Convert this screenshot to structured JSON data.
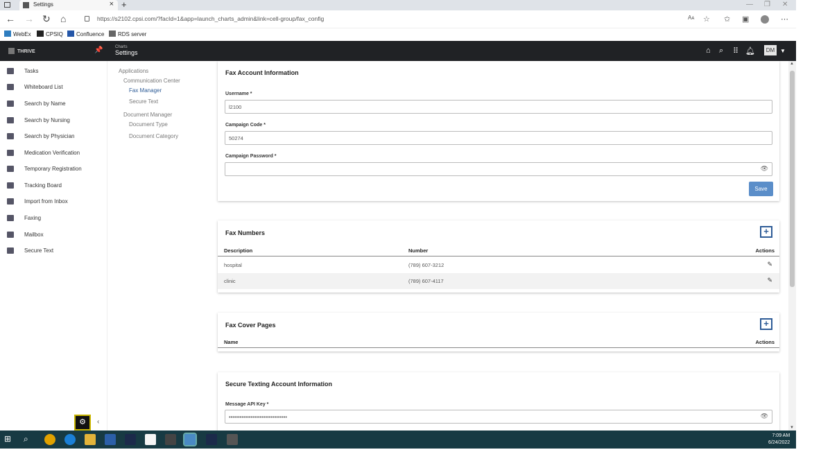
{
  "browser": {
    "tab_title": "Settings",
    "new_tab_glyph": "+",
    "close_glyph": "×",
    "url": "https://s2102.cpsi.com/?facId=1&app=launch_charts_admin&link=cell-group/fax_config",
    "read_aloud_glyph": "Aᴀ",
    "bookmarks": [
      {
        "label": "WebEx",
        "icon": "webex-icon",
        "color": "#2e7dbf"
      },
      {
        "label": "CPSIQ",
        "icon": "cpsiq-icon",
        "color": "#222222"
      },
      {
        "label": "Confluence",
        "icon": "confluence-icon",
        "color": "#2456a8"
      },
      {
        "label": "RDS server",
        "icon": "page-icon",
        "color": "#666666"
      }
    ]
  },
  "app": {
    "brand": "THRIVE",
    "crumb_small": "Charts",
    "crumb_big": "Settings",
    "avatar_initials": "DM"
  },
  "sidenav": {
    "items": [
      {
        "label": "Tasks",
        "icon": "tasks-icon"
      },
      {
        "label": "Whiteboard List",
        "icon": "whiteboard-icon"
      },
      {
        "label": "Search by Name",
        "icon": "search-person-icon"
      },
      {
        "label": "Search by Nursing",
        "icon": "search-nursing-icon"
      },
      {
        "label": "Search by Physician",
        "icon": "search-physician-icon"
      },
      {
        "label": "Medication Verification",
        "icon": "medication-icon"
      },
      {
        "label": "Temporary Registration",
        "icon": "registration-icon"
      },
      {
        "label": "Tracking Board",
        "icon": "tracking-board-icon"
      },
      {
        "label": "Import from Inbox",
        "icon": "import-icon"
      },
      {
        "label": "Faxing",
        "icon": "fax-icon"
      },
      {
        "label": "Mailbox",
        "icon": "mailbox-icon"
      },
      {
        "label": "Secure Text",
        "icon": "secure-text-icon"
      }
    ]
  },
  "subnav": {
    "applications": "Applications",
    "communication_center": "Communication Center",
    "fax_manager": "Fax Manager",
    "secure_text": "Secure Text",
    "document_manager": "Document Manager",
    "document_type": "Document Type",
    "document_category": "Document Category"
  },
  "fax_account": {
    "title": "Fax Account Information",
    "username_label": "Username *",
    "username_value": "l2100",
    "campaign_code_label": "Campaign Code *",
    "campaign_code_value": "50274",
    "campaign_password_label": "Campaign Password *",
    "campaign_password_value": "",
    "save_label": "Save"
  },
  "fax_numbers": {
    "title": "Fax Numbers",
    "add_glyph": "+",
    "headers": {
      "description": "Description",
      "number": "Number",
      "actions": "Actions"
    },
    "rows": [
      {
        "description": "hospital",
        "number": "(789) 607-3212"
      },
      {
        "description": "clinic",
        "number": "(789) 607-4117"
      }
    ]
  },
  "fax_cover_pages": {
    "title": "Fax Cover Pages",
    "add_glyph": "+",
    "headers": {
      "name": "Name",
      "actions": "Actions"
    }
  },
  "secure_texting": {
    "title": "Secure Texting Account Information",
    "api_key_label": "Message API Key *",
    "api_key_value": "••••••••••••••••••••••••••••••••"
  },
  "taskbar": {
    "time": "7:09 AM",
    "date": "6/24/2022"
  },
  "colors": {
    "header_bg": "#202225",
    "accent": "#2d5b96",
    "save_button": "#5b8ec9",
    "taskbar": "#173a43"
  }
}
